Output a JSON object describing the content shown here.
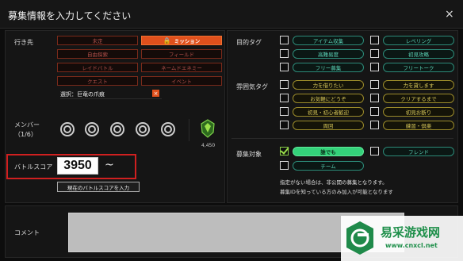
{
  "header": {
    "title": "募集情報を入力してください",
    "close_label": "×"
  },
  "destination": {
    "label": "行き先",
    "options": [
      {
        "label": "未定",
        "active": false
      },
      {
        "label": "ミッション",
        "active": true
      },
      {
        "label": "自由探索",
        "active": false
      },
      {
        "label": "フィールド",
        "active": false
      },
      {
        "label": "レイドバトル",
        "active": false
      },
      {
        "label": "ネームドエネミー",
        "active": false
      },
      {
        "label": "クエスト",
        "active": false
      },
      {
        "label": "イベント",
        "active": false
      }
    ],
    "selected_value": "選択：巨竜の爪痕",
    "clear_label": "×"
  },
  "members": {
    "label": "メンバー",
    "count": "（1/6）",
    "score_value": "4,450"
  },
  "battle_score": {
    "label": "バトルスコア",
    "value": "3950",
    "suffix": "~",
    "input_button": "現在のバトルスコアを入力"
  },
  "purpose_tags": {
    "label": "目的タグ",
    "items": [
      {
        "label": "アイテム収集",
        "checked": false
      },
      {
        "label": "レベリング",
        "checked": false
      },
      {
        "label": "高難易度",
        "checked": false
      },
      {
        "label": "初見攻略",
        "checked": false
      },
      {
        "label": "フリー募集",
        "checked": false
      },
      {
        "label": "フリートーク",
        "checked": false
      }
    ]
  },
  "mood_tags": {
    "label": "雰囲気タグ",
    "items": [
      {
        "label": "力を借りたい",
        "checked": false
      },
      {
        "label": "力を貸します",
        "checked": false
      },
      {
        "label": "お気軽にどうぞ",
        "checked": false
      },
      {
        "label": "クリアするまで",
        "checked": false
      },
      {
        "label": "初見・初心者歓迎",
        "checked": false
      },
      {
        "label": "初見お断り",
        "checked": false
      },
      {
        "label": "周回",
        "checked": false
      },
      {
        "label": "練習・倶楽",
        "checked": false
      }
    ]
  },
  "recruit_target": {
    "label": "募集対象",
    "items": [
      {
        "label": "誰でも",
        "checked": true
      },
      {
        "label": "フレンド",
        "checked": false
      },
      {
        "label": "チーム",
        "checked": false
      }
    ],
    "notes": [
      "指定がない場合は、非公開の募集となります。",
      "募集IDを知っている方のみ加入が可能となります"
    ]
  },
  "comment": {
    "label": "コメント",
    "value": ""
  },
  "watermark": {
    "text": "易采游戏网",
    "url": "www.cnxcl.net"
  },
  "colors": {
    "accent_orange": "#e0501c",
    "tag_teal": "#2c8a78",
    "mood_yellow": "#9a8a2a",
    "target_green": "#34d27a",
    "highlight_red": "#d02020"
  }
}
